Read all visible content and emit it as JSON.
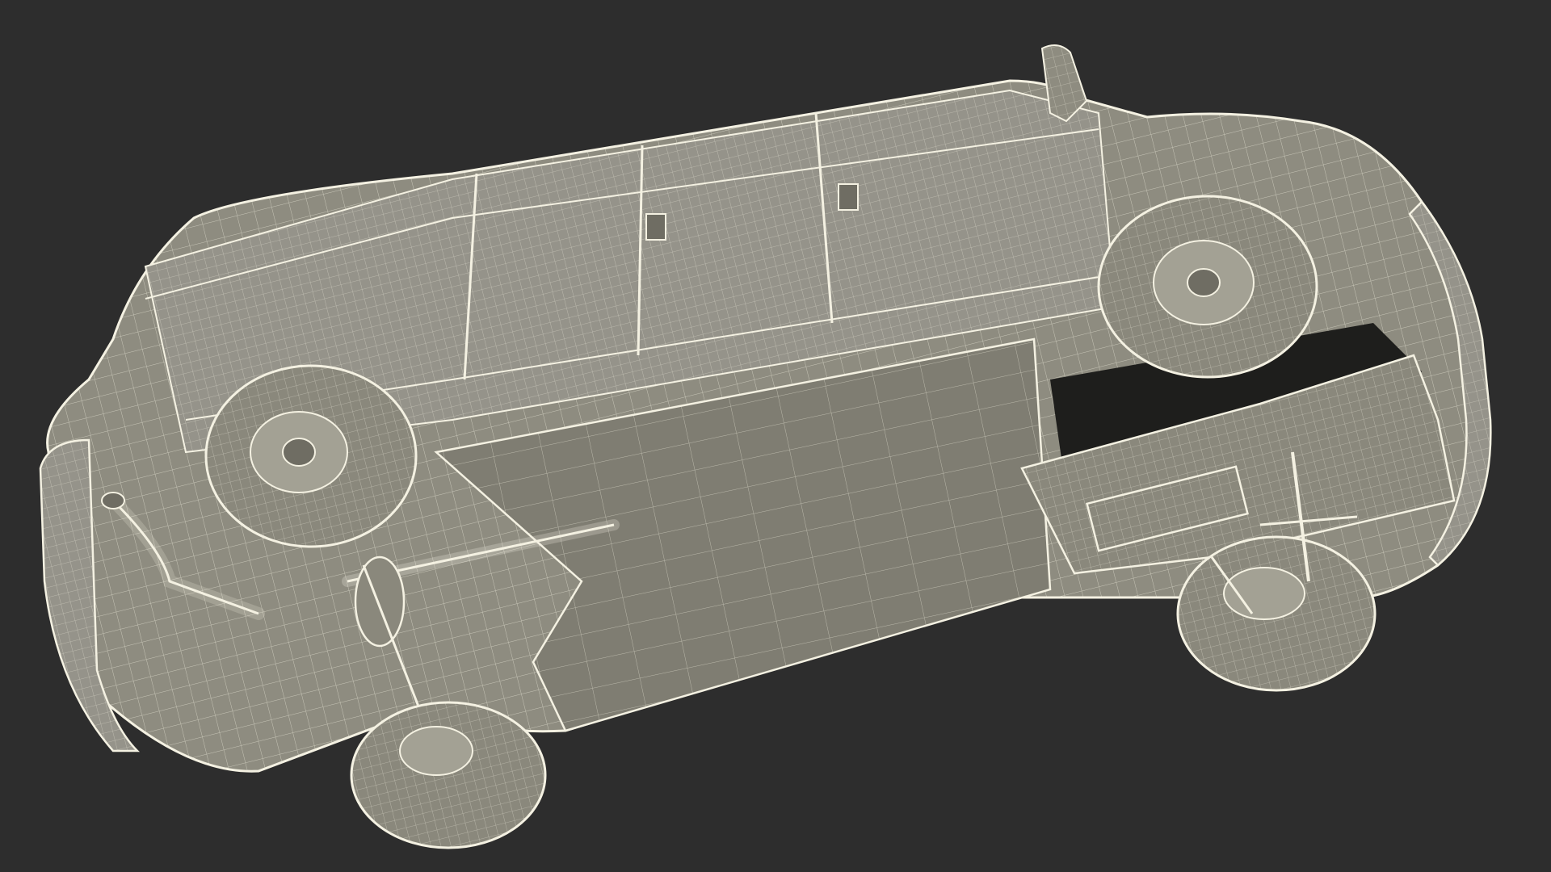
{
  "scene": {
    "background": "#2d2d2d",
    "body_fill": "#8e8c80",
    "body_shade": "#6f6d63",
    "floor_fill": "#7f7d72",
    "wire_color": "#f4f1e2",
    "dark_cavity": "#1e1e1c",
    "tire_fill": "#8a887c",
    "hub_fill": "#a3a194"
  }
}
